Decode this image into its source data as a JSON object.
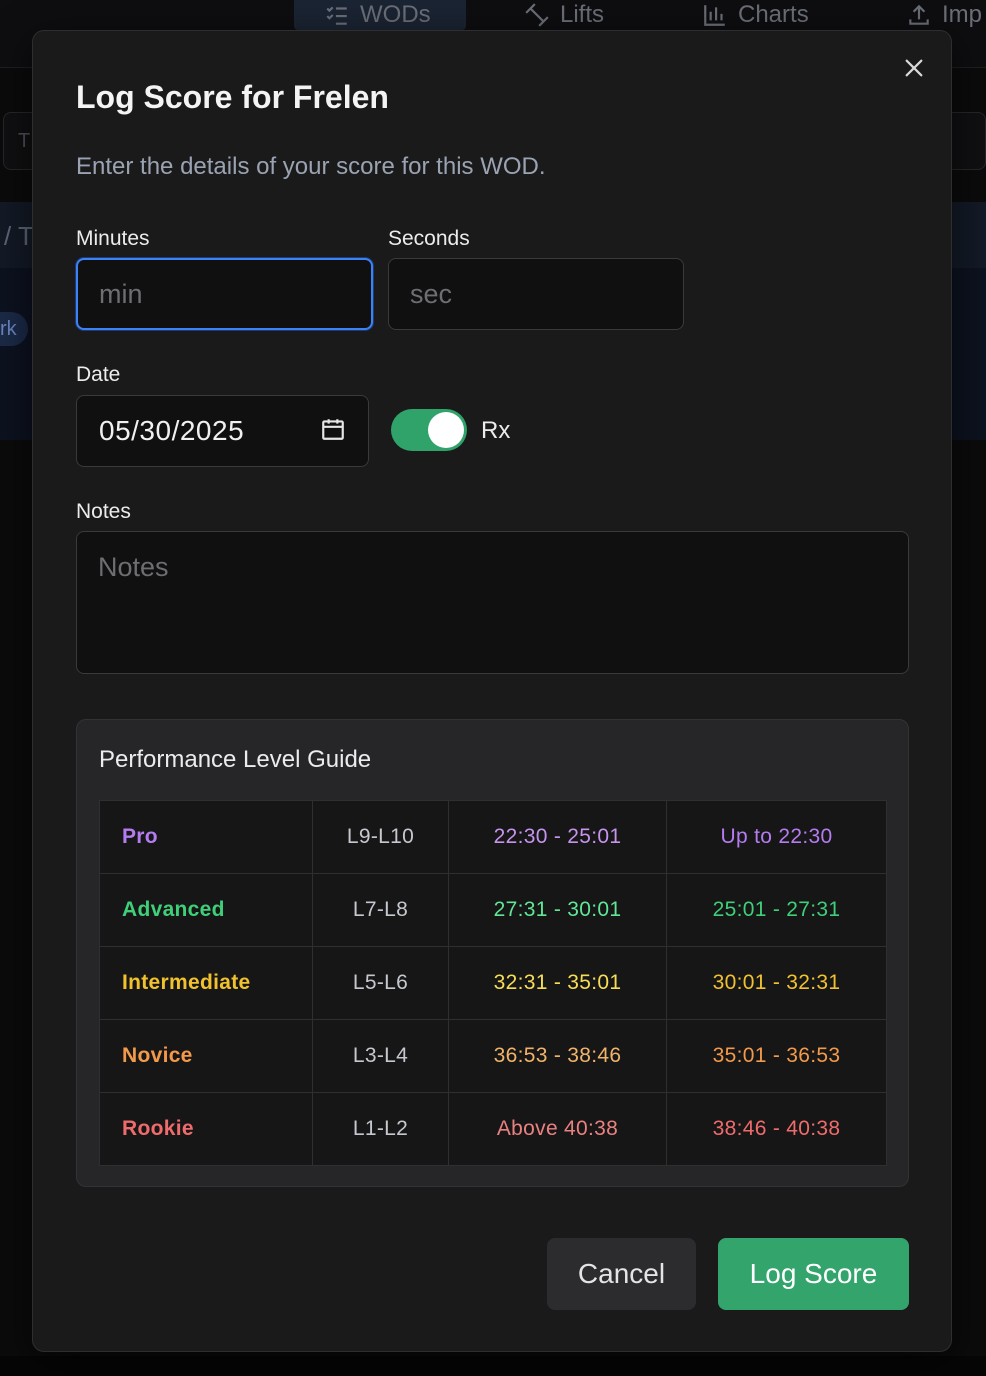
{
  "background": {
    "nav_tabs": [
      {
        "label": "WODs",
        "icon": "list-check-icon"
      },
      {
        "label": "Lifts",
        "icon": "dumbbell-icon"
      },
      {
        "label": "Charts",
        "icon": "bar-chart-icon"
      },
      {
        "label": "Imp",
        "icon": "upload-icon"
      }
    ],
    "search_fragment": "T",
    "band_fragment": "/ T",
    "chip_fragment": "rk"
  },
  "modal": {
    "title": "Log Score for Frelen",
    "subtitle": "Enter the details of your score for this WOD.",
    "minutes": {
      "label": "Minutes",
      "placeholder": "min",
      "value": ""
    },
    "seconds": {
      "label": "Seconds",
      "placeholder": "sec",
      "value": ""
    },
    "date": {
      "label": "Date",
      "value": "05/30/2025"
    },
    "rx": {
      "label": "Rx",
      "checked": true
    },
    "notes": {
      "label": "Notes",
      "placeholder": "Notes",
      "value": ""
    },
    "guide": {
      "title": "Performance Level Guide",
      "rows": [
        {
          "level": "Pro",
          "range": "L9-L10",
          "rx_time": "22:30 - 25:01",
          "scaled_time": "Up to 22:30",
          "color": "#b47cf0"
        },
        {
          "level": "Advanced",
          "range": "L7-L8",
          "rx_time": "27:31 - 30:01",
          "scaled_time": "25:01 - 27:31",
          "color": "#3fcf79"
        },
        {
          "level": "Intermediate",
          "range": "L5-L6",
          "rx_time": "32:31 - 35:01",
          "scaled_time": "30:01 - 32:31",
          "color": "#f2c12e"
        },
        {
          "level": "Novice",
          "range": "L3-L4",
          "rx_time": "36:53 - 38:46",
          "scaled_time": "35:01 - 36:53",
          "color": "#f39a4a"
        },
        {
          "level": "Rookie",
          "range": "L1-L2",
          "rx_time": "Above 40:38",
          "scaled_time": "38:46 - 40:38",
          "color": "#f06b6b"
        }
      ]
    },
    "cancel_label": "Cancel",
    "submit_label": "Log Score"
  }
}
